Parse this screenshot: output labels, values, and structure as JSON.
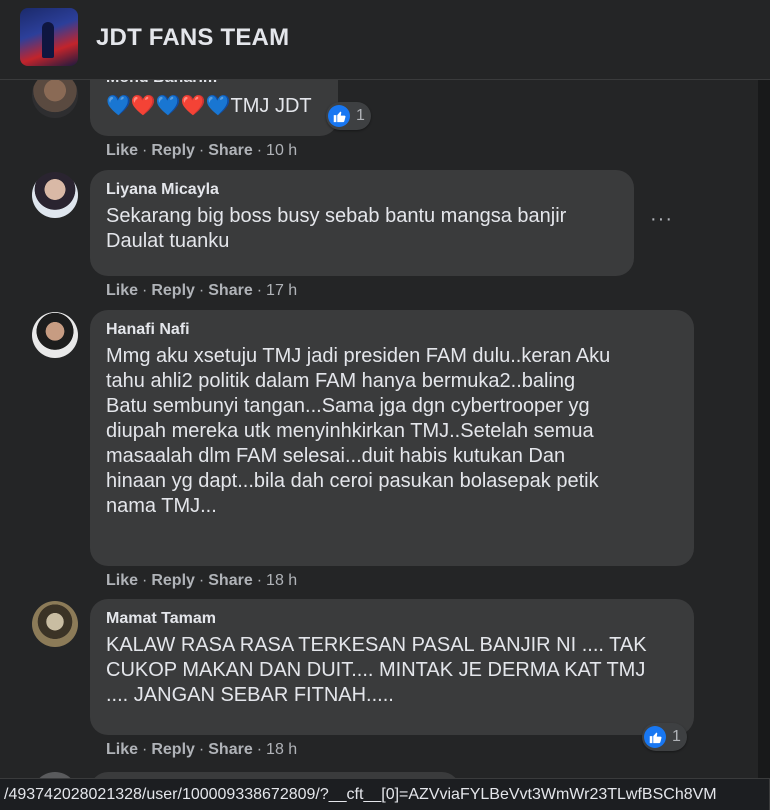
{
  "header": {
    "group_name": "JDT FANS TEAM"
  },
  "actions": {
    "like": "Like",
    "reply": "Reply",
    "share": "Share",
    "sep": "·"
  },
  "comments": [
    {
      "author": "Mohd Baharim",
      "text": "💙❤️💙❤️💙TMJ JDT",
      "time": "10 h",
      "reactions": "1"
    },
    {
      "author": "Liyana Micayla",
      "text": "Sekarang big boss busy sebab bantu mangsa banjir\nDaulat tuanku",
      "time": "17 h"
    },
    {
      "author": "Hanafi Nafi",
      "text": "Mmg aku xsetuju TMJ jadi presiden FAM dulu..keran Aku\ntahu ahli2 politik dalam FAM hanya bermuka2..baling\nBatu sembunyi tangan...Sama jga dgn cybertrooper yg\ndiupah mereka utk menyinhkirkan TMJ..Setelah semua\nmasaalah dlm FAM selesai...duit habis kutukan Dan\nhinaan yg dapt...bila dah ceroi pasukan bolasepak petik\nnama TMJ...",
      "time": "18 h"
    },
    {
      "author": "Mamat Tamam",
      "text": "KALAW RASA RASA TERKESAN PASAL BANJIR NI .... TAK\nCUKOP MAKAN DAN DUIT.... MINTAK JE DERMA KAT TMJ\n.... JANGAN SEBAR FITNAH.....",
      "time": "18 h",
      "reactions": "1"
    }
  ],
  "more_glyph": "···",
  "status_url": "/493742028021328/user/100009338672809/?__cft__[0]=AZVviaFYLBeVvt3WmWr23TLwfBSCh8VM",
  "colors": {
    "background": "#242526",
    "bubble": "#3a3b3c",
    "like_blue": "#1877f2",
    "meta_text": "#b0b3b8"
  }
}
